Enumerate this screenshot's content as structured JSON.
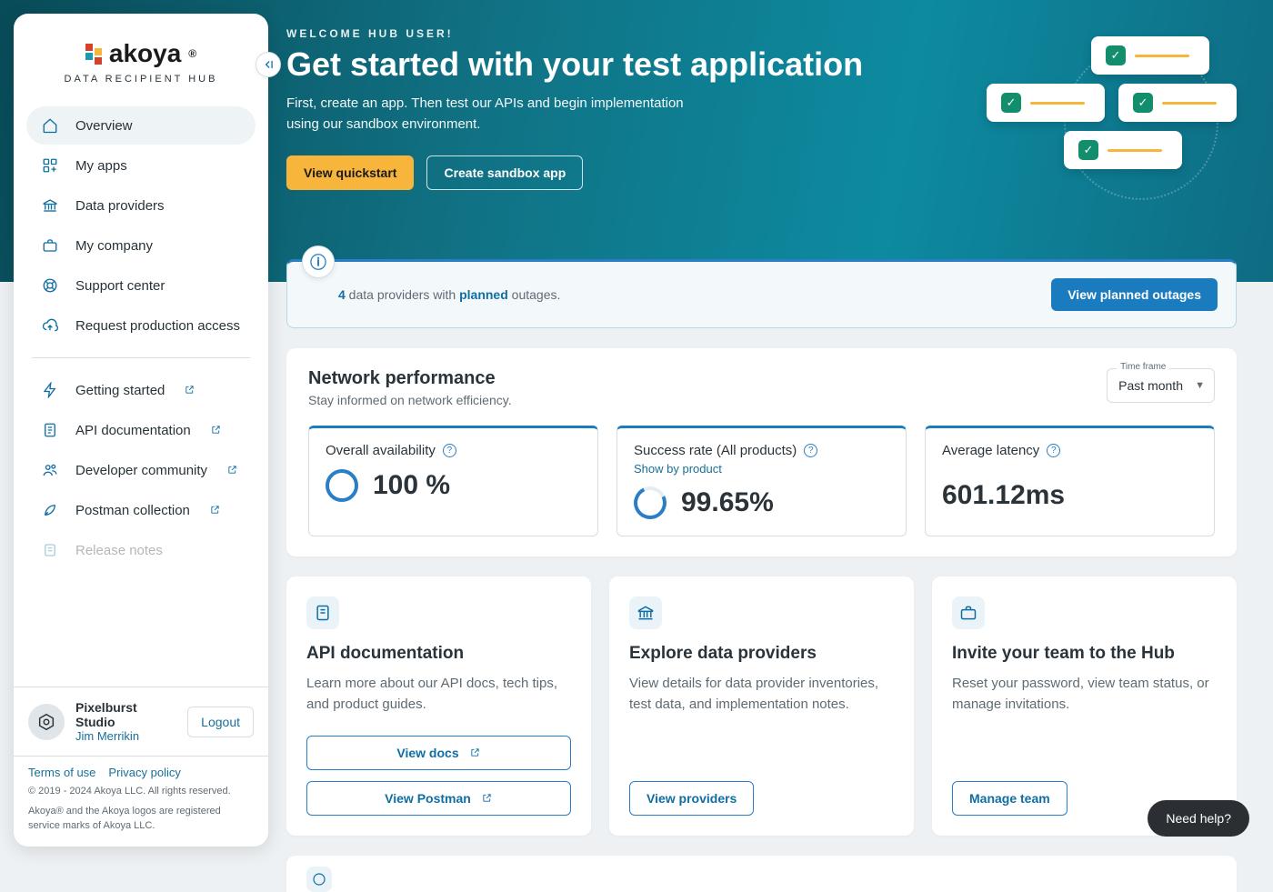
{
  "brand": {
    "name": "akoya",
    "subtitle": "DATA RECIPIENT HUB"
  },
  "sidebar": {
    "primary": [
      {
        "label": "Overview"
      },
      {
        "label": "My apps"
      },
      {
        "label": "Data providers"
      },
      {
        "label": "My company"
      },
      {
        "label": "Support center"
      },
      {
        "label": "Request production access"
      }
    ],
    "secondary": [
      {
        "label": "Getting started"
      },
      {
        "label": "API documentation"
      },
      {
        "label": "Developer community"
      },
      {
        "label": "Postman collection"
      },
      {
        "label": "Release notes"
      }
    ]
  },
  "user": {
    "company": "Pixelburst Studio",
    "name": "Jim Merrikin",
    "logout_label": "Logout"
  },
  "legal": {
    "terms": "Terms of use",
    "privacy": "Privacy policy",
    "copyright": "© 2019 - 2024 Akoya LLC. All rights reserved.",
    "trademark": "Akoya® and the Akoya logos are registered service marks of Akoya LLC."
  },
  "hero": {
    "welcome": "WELCOME HUB USER!",
    "title": "Get started with your test application",
    "body": "First, create an app. Then test our APIs and begin implementation using our sandbox environment.",
    "primary_btn": "View quickstart",
    "secondary_btn": "Create sandbox app"
  },
  "banner": {
    "count": "4",
    "pre": " data providers with ",
    "bold": "planned",
    "post": " outages.",
    "button": "View planned outages"
  },
  "network": {
    "title": "Network performance",
    "subtitle": "Stay informed on network efficiency.",
    "timeframe_label": "Time frame",
    "timeframe_value": "Past month",
    "metrics": [
      {
        "title": "Overall availability",
        "value": "100 %"
      },
      {
        "title": "Success rate (All products)",
        "sub": "Show by product",
        "value": "99.65%"
      },
      {
        "title": "Average latency",
        "value": "601.12ms"
      }
    ]
  },
  "tiles": [
    {
      "title": "API documentation",
      "body": "Learn more about our API docs, tech tips, and product guides.",
      "buttons": [
        "View docs",
        "View Postman"
      ]
    },
    {
      "title": "Explore data providers",
      "body": "View details for data provider inventories, test data, and implementation notes.",
      "buttons": [
        "View providers"
      ]
    },
    {
      "title": "Invite your team to the Hub",
      "body": "Reset your password, view team status, or manage invitations.",
      "buttons": [
        "Manage team"
      ]
    }
  ],
  "help_fab": "Need help?"
}
